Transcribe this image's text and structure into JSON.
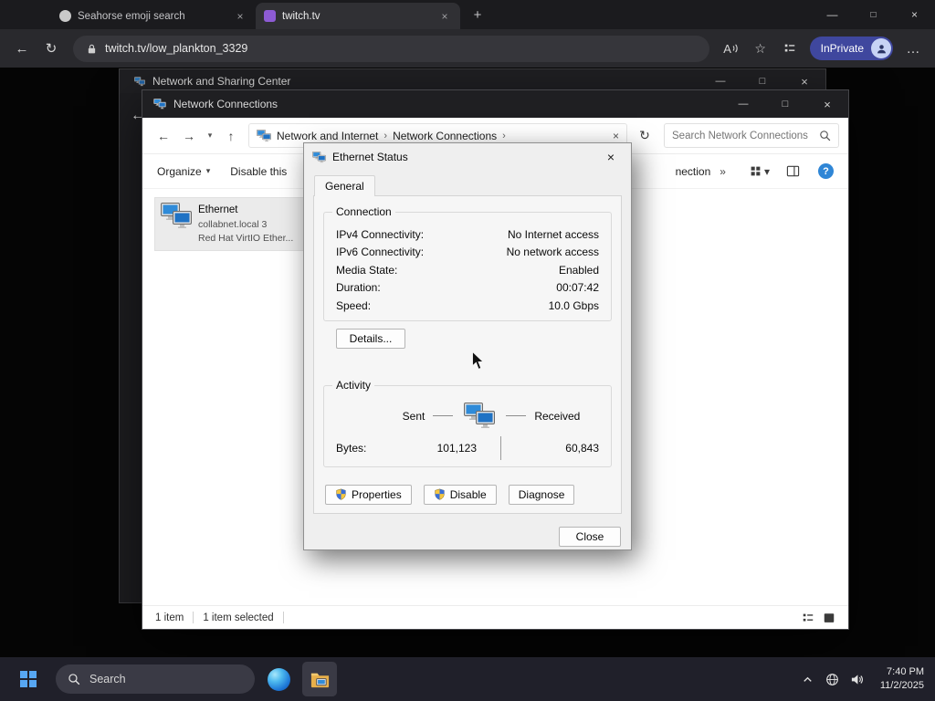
{
  "colors": {
    "accent_blue": "#2f86d6",
    "inprivate_badge": "#3f479e",
    "selection_gray": "#ebebeb",
    "titlebar_dark": "#1f1f22",
    "taskbar_bg": "#20202a",
    "start_blue": "#57a7f3",
    "monitor_screen_blue": "#2f8bd9"
  },
  "icons": {
    "back": "←",
    "forward": "→",
    "up": "↑",
    "refresh": "↻",
    "dropdown": "▾",
    "chevron_right": "›",
    "chevrons_right": "»",
    "close": "×",
    "minimize": "—",
    "maximize": "□",
    "more": "…",
    "new_tab": "+",
    "star": "☆",
    "read_aloud_letter": "A",
    "help": "?"
  },
  "browser": {
    "tabs": [
      {
        "title": "Seahorse emoji search"
      },
      {
        "title": "twitch.tv"
      }
    ],
    "address": "twitch.tv/low_plankton_3329",
    "inprivate": "InPrivate"
  },
  "nsc_window": {
    "title": "Network and Sharing Center"
  },
  "nc_window": {
    "title": "Network Connections",
    "breadcrumbs": [
      "Network and Internet",
      "Network Connections"
    ],
    "search_placeholder": "Search Network Connections",
    "commands": {
      "organize": "Organize",
      "disable_partial": "Disable this",
      "right_partial": "nection"
    },
    "item": {
      "name": "Ethernet",
      "network": "collabnet.local 3",
      "device": "Red Hat VirtIO Ether..."
    },
    "status": {
      "items": "1 item",
      "selected": "1 item selected"
    }
  },
  "dialog": {
    "title": "Ethernet Status",
    "tab_general": "General",
    "connection": {
      "legend": "Connection",
      "rows": [
        {
          "label": "IPv4 Connectivity:",
          "value": "No Internet access"
        },
        {
          "label": "IPv6 Connectivity:",
          "value": "No network access"
        },
        {
          "label": "Media State:",
          "value": "Enabled"
        },
        {
          "label": "Duration:",
          "value": "00:07:42"
        },
        {
          "label": "Speed:",
          "value": "10.0 Gbps"
        }
      ]
    },
    "details_button": "Details...",
    "activity": {
      "legend": "Activity",
      "sent": "Sent",
      "received": "Received",
      "bytes_label": "Bytes:",
      "sent_bytes": "101,123",
      "received_bytes": "60,843"
    },
    "buttons": {
      "properties": "Properties",
      "disable": "Disable",
      "diagnose": "Diagnose",
      "close": "Close"
    }
  },
  "taskbar": {
    "search_placeholder": "Search",
    "clock": {
      "time": "7:40 PM",
      "date": "11/2/2025"
    }
  }
}
